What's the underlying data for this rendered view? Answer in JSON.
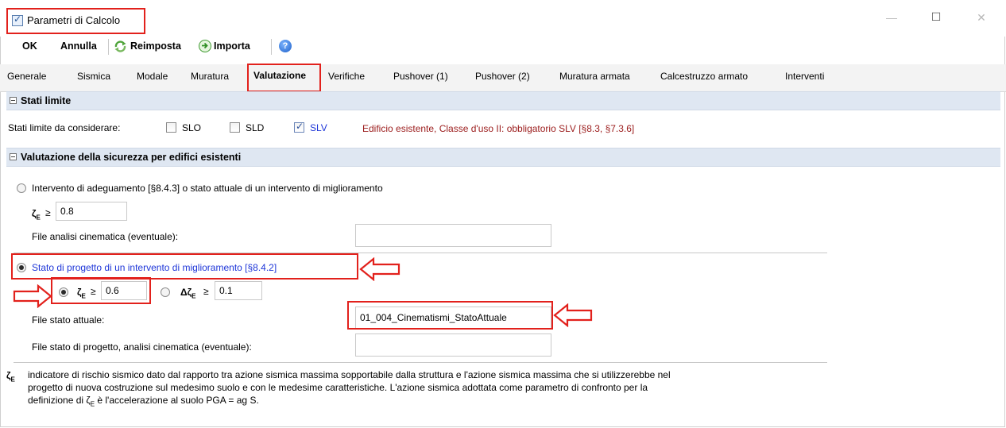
{
  "window": {
    "title": "Parametri di Calcolo",
    "minimize": "—",
    "maximize": "☐",
    "close": "✕"
  },
  "toolbar": {
    "ok": "OK",
    "annulla": "Annulla",
    "reimposta": "Reimposta",
    "importa": "Importa"
  },
  "tabs": [
    "Generale",
    "Sismica",
    "Modale",
    "Muratura",
    "Valutazione",
    "Verifiche",
    "Pushover (1)",
    "Pushover (2)",
    "Muratura armata",
    "Calcestruzzo armato",
    "Interventi"
  ],
  "active_tab": "Valutazione",
  "stati_limite": {
    "header": "Stati limite",
    "label": "Stati limite da considerare:",
    "slo": "SLO",
    "sld": "SLD",
    "slv": "SLV",
    "note": "Edificio esistente, Classe d'uso II: obbligatorio SLV [§8.3, §7.3.6]"
  },
  "valutazione": {
    "header": "Valutazione della sicurezza per edifici esistenti",
    "opt1_label": "Intervento di adeguamento [§8.4.3] o stato attuale di un intervento di miglioramento",
    "zeta_label": "ζ",
    "zeta_sub": "E",
    "geq": "≥",
    "opt1_zeta_value": "0.8",
    "file_cinematica_label": "File analisi cinematica (eventuale):",
    "file_cinematica_value": "",
    "opt2_label": "Stato di progetto di un intervento di miglioramento [§8.4.2]",
    "opt2_zeta_value": "0.6",
    "delta_label": "Δζ",
    "opt2_delta_value": "0.1",
    "file_stato_attuale_label": "File stato attuale:",
    "file_stato_attuale_value": "01_004_Cinematismi_StatoAttuale",
    "file_progetto_label": "File stato di progetto, analisi cinematica (eventuale):",
    "file_progetto_value": ""
  },
  "footnote": {
    "symbol": "ζ",
    "sub": "E",
    "line1": "indicatore di rischio sismico dato dal rapporto tra azione sismica massima sopportabile dalla struttura e l'azione sismica massima che si utilizzerebbe nel",
    "line2": "progetto di nuova costruzione sul medesimo suolo e con le medesime caratteristiche. L'azione sismica adottata come parametro di confronto per la",
    "line3": "definizione di ζ",
    "line3_sub": "E",
    "line3_rest": " è l'accelerazione al suolo PGA = ag S."
  },
  "colors": {
    "highlight_red": "#e2211c",
    "section_bg": "#dfe7f2",
    "note_red": "#9b1b1b",
    "option_blue": "#1d35d8"
  },
  "icons": {
    "app": "checkbox-app-icon",
    "reimposta": "refresh-icon",
    "importa": "arrow-right-circle-icon",
    "help": "help-icon"
  }
}
